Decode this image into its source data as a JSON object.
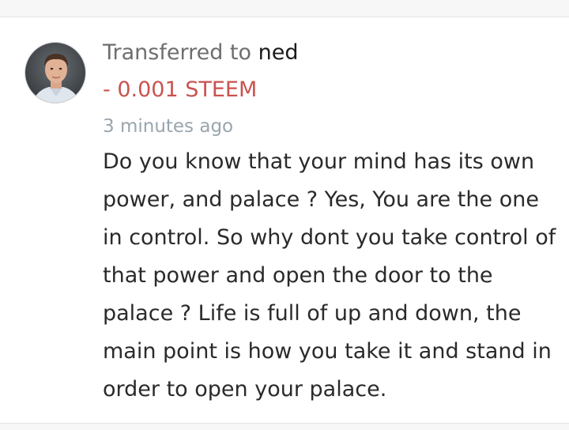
{
  "transfer": {
    "prefix": "Transferred to",
    "recipient": "ned",
    "amount": "- 0.001 STEEM",
    "timestamp": "3 minutes ago",
    "memo_lines": [
      "Do you know that your mind has its own",
      "power, and palace ? Yes, You are the one",
      "in control. So why dont you take control of",
      "that power and open the door to the",
      "palace ? Life is full of up and down, the",
      "main point is how you take it and stand in",
      "order to open your palace."
    ]
  },
  "colors": {
    "amount_negative": "#c9534f",
    "timestamp": "#9aa5ad",
    "label": "#6e6e6e",
    "username": "#1a1a1a"
  },
  "icons": {
    "avatar": "user-avatar-photo"
  }
}
